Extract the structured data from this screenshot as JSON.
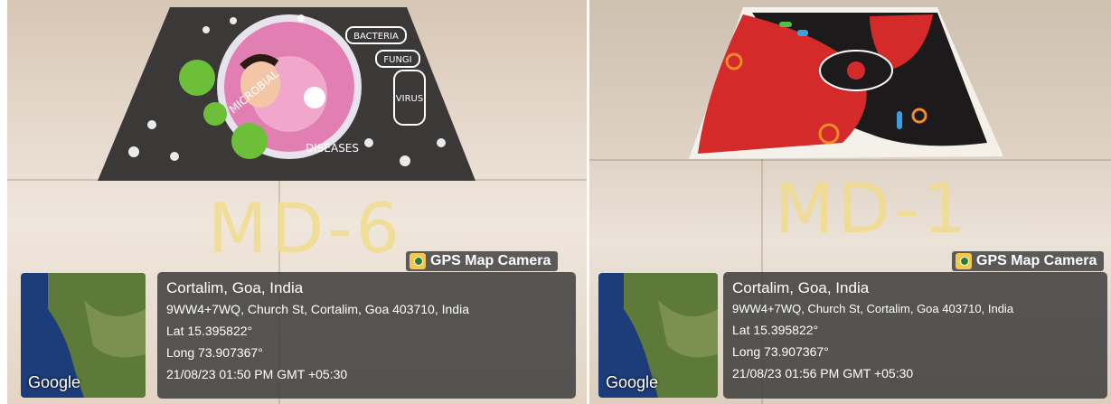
{
  "photos": [
    {
      "chalk_text": "MD-6",
      "overlay_badge": "GPS Map Camera",
      "map_label": "Google",
      "location": {
        "city": "Cortalim, Goa, India",
        "address": "9WW4+7WQ, Church St, Cortalim, Goa 403710, India",
        "lat": "Lat 15.395822°",
        "long": "Long 73.907367°",
        "datetime": "21/08/23 01:50 PM GMT +05:30"
      },
      "rangoli_words": [
        "BACTERIA",
        "FUNGI",
        "VIRUS",
        "MICROBIAL",
        "DISEASES"
      ]
    },
    {
      "chalk_text": "MD-1",
      "overlay_badge": "GPS Map Camera",
      "map_label": "Google",
      "location": {
        "city": "Cortalim, Goa, India",
        "address": "9WW4+7WQ, Church St, Cortalim, Goa 403710, India",
        "lat": "Lat 15.395822°",
        "long": "Long 73.907367°",
        "datetime": "21/08/23 01:56 PM GMT +05:30"
      }
    }
  ]
}
